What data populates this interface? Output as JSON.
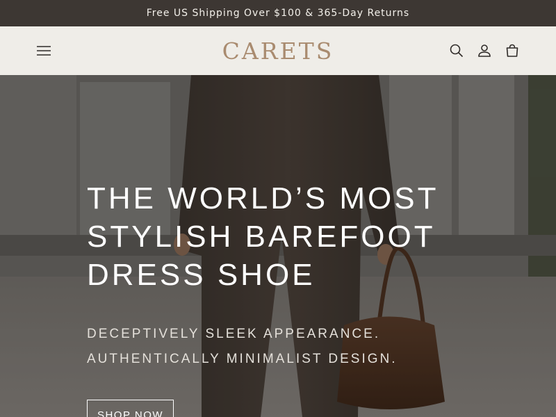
{
  "announcement": {
    "text": "Free US Shipping Over $100 & 365-Day Returns"
  },
  "header": {
    "logo": "CARETS",
    "icons": [
      "menu-icon",
      "search-icon",
      "account-icon",
      "cart-icon"
    ]
  },
  "hero": {
    "title_lines": [
      "THE WORLD’S MOST",
      "STYLISH BAREFOOT",
      "DRESS SHOE"
    ],
    "subtitle_lines": [
      "DECEPTIVELY SLEEK APPEARANCE.",
      "AUTHENTICALLY MINIMALIST DESIGN."
    ],
    "cta_label": "SHOP NOW"
  },
  "colors": {
    "announcement_bg": "#3d3733",
    "header_bg": "#efede8",
    "logo": "#a98b6f",
    "hero_text": "#ffffff"
  }
}
